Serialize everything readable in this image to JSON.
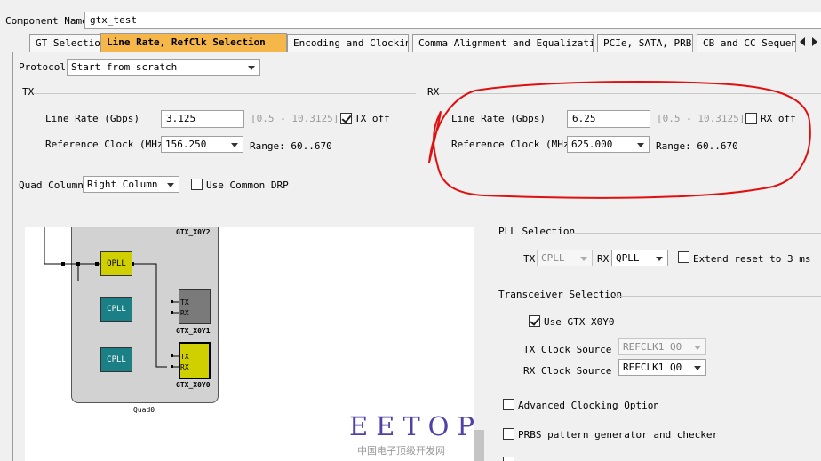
{
  "component": {
    "label": "Component Name",
    "value": "gtx_test"
  },
  "tabs": [
    {
      "label": "GT Selection",
      "active": false
    },
    {
      "label": "Line Rate, RefClk Selection",
      "active": true
    },
    {
      "label": "Encoding and Clocking",
      "active": false
    },
    {
      "label": "Comma Alignment and Equalization",
      "active": false
    },
    {
      "label": "PCIe, SATA, PRBS",
      "active": false
    },
    {
      "label": "CB and CC Sequence",
      "active": false
    }
  ],
  "protocol": {
    "label": "Protocol",
    "value": "Start from scratch"
  },
  "tx": {
    "section": "TX",
    "line_rate_label": "Line Rate (Gbps)",
    "line_rate_value": "3.125",
    "line_rate_range": "[0.5 - 10.3125]",
    "off_label": "TX off",
    "off_checked": true,
    "ref_clock_label": "Reference Clock (MHz)",
    "ref_clock_value": "156.250",
    "range_text": "Range: 60..670"
  },
  "rx": {
    "section": "RX",
    "line_rate_label": "Line Rate (Gbps)",
    "line_rate_value": "6.25",
    "line_rate_range": "[0.5 - 10.3125]",
    "off_label": "RX off",
    "off_checked": false,
    "ref_clock_label": "Reference Clock (MHz)",
    "ref_clock_value": "625.000",
    "range_text": "Range: 60..670"
  },
  "quad_column": {
    "label": "Quad Column",
    "value": "Right Column"
  },
  "common_drp": {
    "label": "Use Common DRP",
    "checked": false
  },
  "pll": {
    "section": "PLL Selection",
    "tx_label": "TX",
    "tx_value": "CPLL",
    "rx_label": "RX",
    "rx_value": "QPLL",
    "extend_label": "Extend reset to 3 ms",
    "extend_checked": false
  },
  "transceiver": {
    "section": "Transceiver Selection",
    "use_label": "Use GTX X0Y0",
    "use_checked": true,
    "tx_clock_label": "TX Clock Source",
    "tx_clock_value": "REFCLK1 Q0",
    "rx_clock_label": "RX Clock Source",
    "rx_clock_value": "REFCLK1 Q0"
  },
  "advanced": {
    "label": "Advanced Clocking Option",
    "checked": false
  },
  "prbs": {
    "label": "PRBS pattern generator and checker",
    "checked": false
  },
  "diagram": {
    "gtx_top": "GTX_X0Y2",
    "qpll": "QPLL",
    "cpll": "CPLL",
    "gtx_y1": "GTX_X0Y1",
    "gtx_y0": "GTX_X0Y0",
    "tx_pin": "TX",
    "rx_pin": "RX",
    "quad": "Quad0"
  },
  "watermark": {
    "brand": "EETOP",
    "sub": "中国电子顶级开发网"
  },
  "colors": {
    "active_tab": "#f6b74a",
    "qpll_active": "#d0d000",
    "cpll": "#1b7f86",
    "gtx_inactive": "#7a7a7a",
    "annotation": "#e01010"
  }
}
